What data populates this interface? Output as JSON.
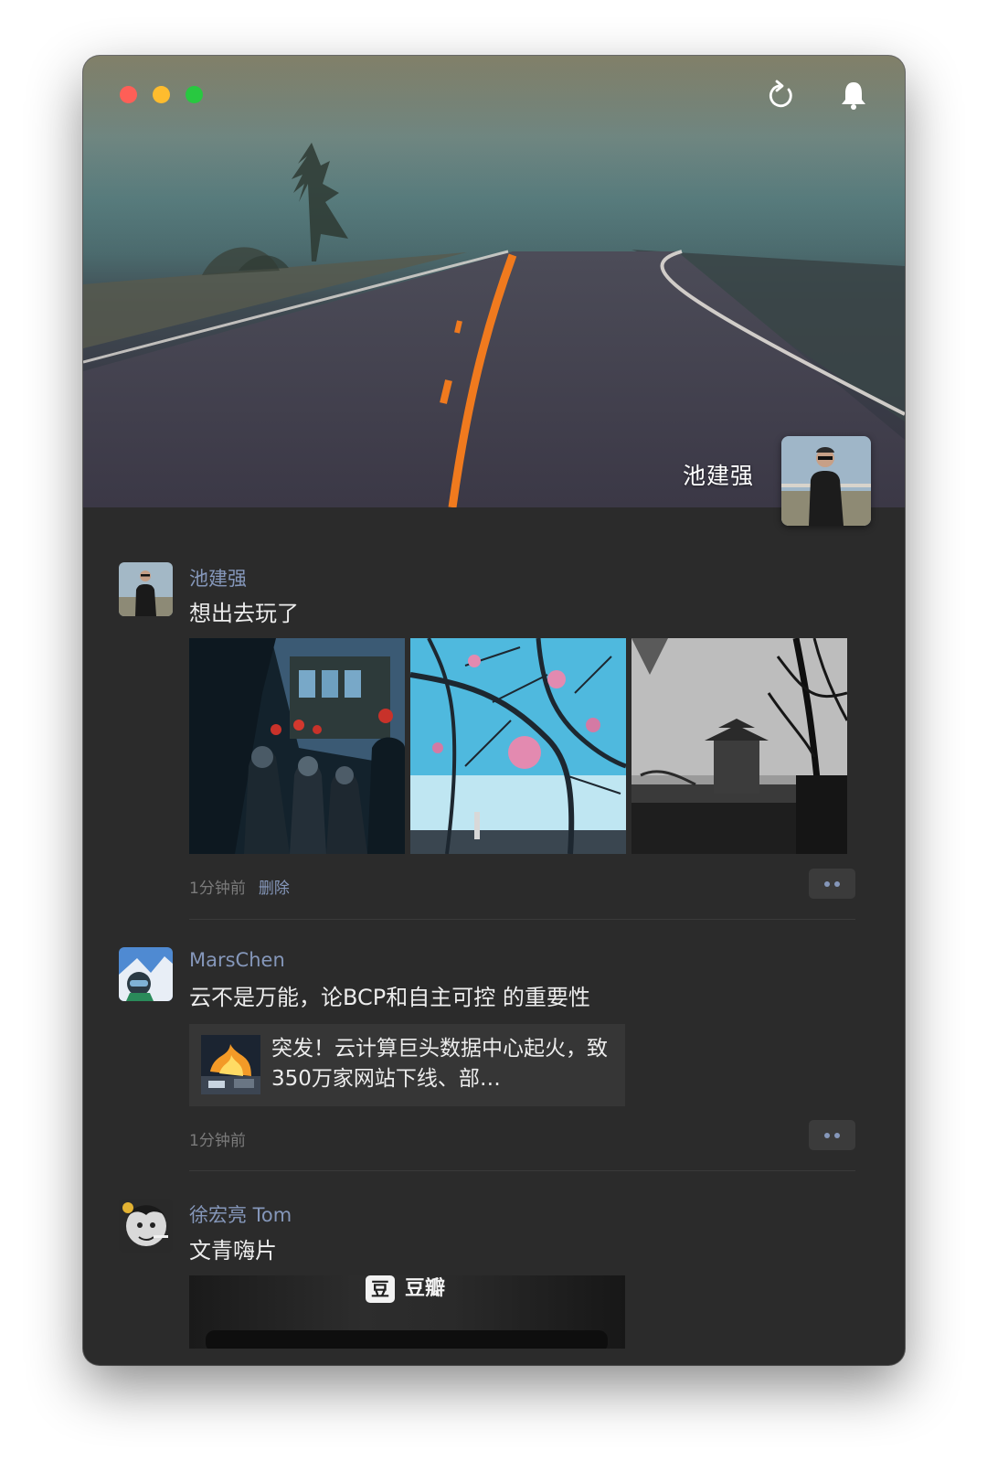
{
  "window": {
    "traffic_lights": [
      "close",
      "minimize",
      "zoom"
    ]
  },
  "header": {
    "icons": [
      "refresh-icon",
      "bell-icon"
    ],
    "profile_name": "池建强"
  },
  "posts": [
    {
      "author": "池建强",
      "text": "想出去玩了",
      "photos": [
        "street-crowd-photo",
        "tree-lanterns-photo",
        "drum-tower-photo"
      ],
      "time": "1分钟前",
      "delete_label": "删除"
    },
    {
      "author": "MarsChen",
      "text": "云不是万能，论BCP和自主可控 的重要性",
      "link": {
        "title": "突发！云计算巨头数据中心起火，致350万家网站下线、部…"
      },
      "time": "1分钟前"
    },
    {
      "author": "徐宏亮 Tom",
      "text": "文青嗨片",
      "share": {
        "logo": "豆",
        "brand": "豆瓣"
      }
    }
  ],
  "colors": {
    "background": "#2b2b2b",
    "author_link": "#8597ba",
    "text": "#ececec",
    "meta": "#7b7b7b"
  }
}
